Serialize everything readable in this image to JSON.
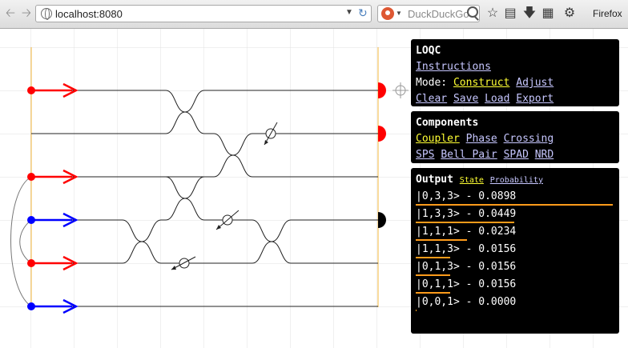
{
  "browser": {
    "url": "localhost:8080",
    "search_placeholder": "DuckDuckGo",
    "menu_label": "Firefox"
  },
  "loqc": {
    "title": "LOQC",
    "instructions_link": "Instructions",
    "mode_label": "Mode:",
    "modes": [
      {
        "label": "Construct",
        "active": true
      },
      {
        "label": "Adjust",
        "active": false
      }
    ],
    "actions": [
      "Clear",
      "Save",
      "Load",
      "Export"
    ]
  },
  "components": {
    "title": "Components",
    "items": [
      {
        "label": "Coupler",
        "active": true
      },
      {
        "label": "Phase",
        "active": false
      },
      {
        "label": "Crossing",
        "active": false
      },
      {
        "label": "SPS",
        "active": false
      },
      {
        "label": "Bell Pair",
        "active": false
      },
      {
        "label": "SPAD",
        "active": false
      },
      {
        "label": "NRD",
        "active": false
      }
    ]
  },
  "output": {
    "title": "Output",
    "tabs": [
      {
        "label": "State",
        "active": true
      },
      {
        "label": "Probability",
        "active": false
      }
    ],
    "rows": [
      {
        "state": "|0,3,3>",
        "prob_text": "0.0898",
        "prob": 0.0898
      },
      {
        "state": "|1,3,3>",
        "prob_text": "0.0449",
        "prob": 0.0449
      },
      {
        "state": "|1,1,1>",
        "prob_text": "0.0234",
        "prob": 0.0234
      },
      {
        "state": "|1,1,3>",
        "prob_text": "0.0156",
        "prob": 0.0156
      },
      {
        "state": "|0,1,3>",
        "prob_text": "0.0156",
        "prob": 0.0156
      },
      {
        "state": "|0,1,1>",
        "prob_text": "0.0156",
        "prob": 0.0156
      },
      {
        "state": "|0,0,1>",
        "prob_text": "0.0000",
        "prob": 0.0
      }
    ]
  },
  "colors": {
    "photon_source": "#ff0000",
    "bell_source": "#0000ff",
    "detector_red": "#ff0000",
    "detector_black": "#000000",
    "accent_orange": "#ff9b1a",
    "link": "#c7c7ff",
    "link_active": "#ffff33"
  }
}
